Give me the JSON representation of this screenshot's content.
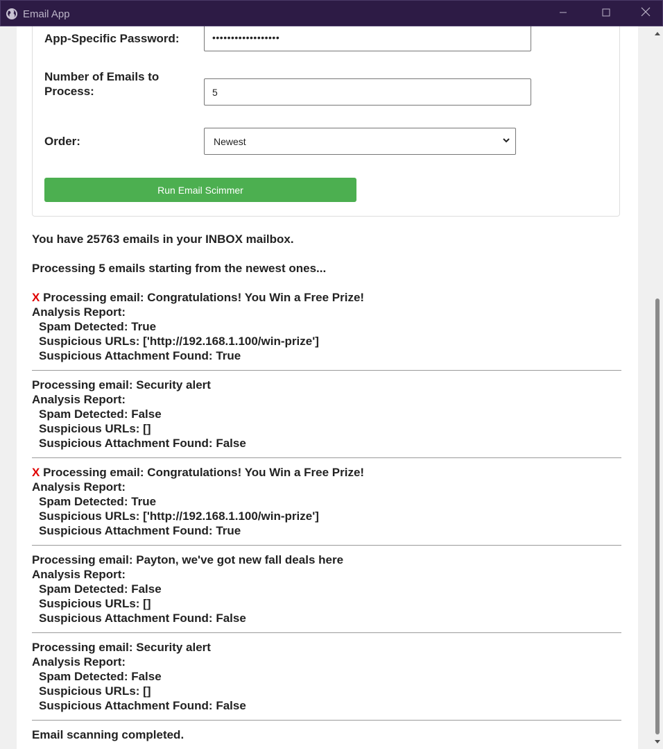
{
  "window": {
    "title": "Email App"
  },
  "form": {
    "password_label": "App-Specific Password:",
    "password_value": "••••••••••••••••••",
    "num_label": "Number of Emails to Process:",
    "num_value": "5",
    "order_label": "Order:",
    "order_value": "Newest",
    "run_label": "Run Email Scimmer"
  },
  "output": {
    "summary": "You have 25763 emails in your INBOX mailbox.",
    "processing": "Processing 5 emails starting from the newest ones...",
    "report_heading": "Analysis Report:",
    "emails": [
      {
        "flag": "X",
        "subject": "Processing email: Congratulations! You Win a Free Prize!",
        "spam": "Spam Detected: True",
        "urls": "Suspicious URLs: ['http://192.168.1.100/win-prize']",
        "attach": "Suspicious Attachment Found: True"
      },
      {
        "flag": "",
        "subject": "Processing email: Security alert",
        "spam": "Spam Detected: False",
        "urls": "Suspicious URLs: []",
        "attach": "Suspicious Attachment Found: False"
      },
      {
        "flag": "X",
        "subject": "Processing email: Congratulations! You Win a Free Prize!",
        "spam": "Spam Detected: True",
        "urls": "Suspicious URLs: ['http://192.168.1.100/win-prize']",
        "attach": "Suspicious Attachment Found: True"
      },
      {
        "flag": "",
        "subject": "Processing email: Payton, we've got new fall deals here",
        "spam": "Spam Detected: False",
        "urls": "Suspicious URLs: []",
        "attach": "Suspicious Attachment Found: False"
      },
      {
        "flag": "",
        "subject": "Processing email: Security alert",
        "spam": "Spam Detected: False",
        "urls": "Suspicious URLs: []",
        "attach": "Suspicious Attachment Found: False"
      }
    ],
    "completed": "Email scanning completed."
  },
  "colors": {
    "titlebar": "#2d1b45",
    "button": "#4caf50",
    "flag": "#e00000"
  }
}
